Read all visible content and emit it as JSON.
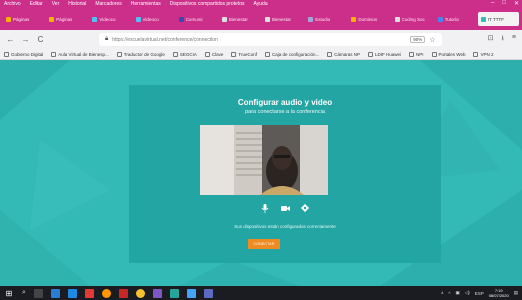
{
  "menubar": {
    "items": [
      "Archivo",
      "Editar",
      "Ver",
      "Historial",
      "Marcadores",
      "Herramientas",
      "Dispositivos compartidos protetos",
      "Ayuda"
    ],
    "win_controls": [
      "–",
      "□",
      "✕"
    ]
  },
  "tabs": [
    {
      "label": "Páginas",
      "color": "#f4b400",
      "active": false
    },
    {
      "label": "Páginas",
      "color": "#f4b400",
      "active": false
    },
    {
      "label": "Videoco",
      "color": "#4fc3f7",
      "active": false
    },
    {
      "label": "Videoco",
      "color": "#4fc3f7",
      "active": false
    },
    {
      "label": "Comunic",
      "color": "#3949ab",
      "active": false
    },
    {
      "label": "Bienestar",
      "color": "#e0e0e0",
      "active": false
    },
    {
      "label": "Bienestar",
      "color": "#e0e0e0",
      "active": false
    },
    {
      "label": "Estudio",
      "color": "#9fa8da",
      "active": false
    },
    {
      "label": "Dominios",
      "color": "#ffb300",
      "active": false
    },
    {
      "label": "Coding Soc",
      "color": "#e0e0e0",
      "active": false
    },
    {
      "label": "Tutoría",
      "color": "#4285f4",
      "active": false
    },
    {
      "label": "IT TTTF",
      "color": "#33b9b6",
      "active": true
    }
  ],
  "navbar": {
    "back": "←",
    "forward": "→",
    "reload": "C",
    "url": "https://escuelavirtual.net/conference/connection",
    "zoom": "90%",
    "star": "☆",
    "right_icons": [
      "⊡",
      "⭳",
      "≡"
    ]
  },
  "bookmarks": [
    "Gobierno Digital",
    "Aula Virtual de Bienesp...",
    "Traductor de Google",
    "SEGCIA",
    "Clave",
    "TrueConf",
    "Caja de configuración...",
    "Cámaras NP",
    "LDIF Huawei",
    "NPI",
    "Portales Web",
    "VPN 2"
  ],
  "conference": {
    "title": "Configurar audio y video",
    "subtitle": "para conectarse a la conferencia",
    "status": "Sus dispositivos están configurados correctamente",
    "connect_label": "CONECTAR",
    "accent": "#ee8c23",
    "background": "#33b9b6"
  },
  "taskbar": {
    "start": "⊞",
    "tray_items": [
      "ᴬ",
      "^",
      "ESP"
    ],
    "time": "7:19",
    "date": "08/07/2020"
  }
}
